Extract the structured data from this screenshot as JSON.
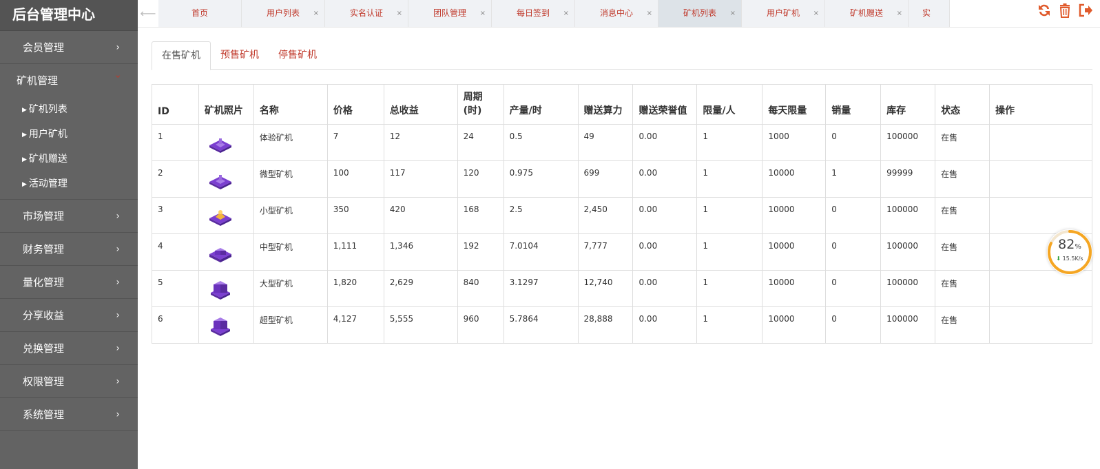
{
  "sidebar": {
    "brand": "后台管理中心",
    "menu": [
      {
        "label": "会员管理"
      },
      {
        "label": "矿机管理",
        "open": true,
        "children": [
          "矿机列表",
          "用户矿机",
          "矿机赠送",
          "活动管理"
        ]
      },
      {
        "label": "市场管理"
      },
      {
        "label": "财务管理"
      },
      {
        "label": "量化管理"
      },
      {
        "label": "分享收益"
      },
      {
        "label": "兑换管理"
      },
      {
        "label": "权限管理"
      },
      {
        "label": "系统管理"
      }
    ]
  },
  "tabbar": {
    "left_arrow": "⟵",
    "tabs": [
      {
        "label": "首页",
        "closable": false
      },
      {
        "label": "用户列表",
        "closable": true
      },
      {
        "label": "实名认证",
        "closable": true
      },
      {
        "label": "团队管理",
        "closable": true
      },
      {
        "label": "每日签到",
        "closable": true
      },
      {
        "label": "消息中心",
        "closable": true
      },
      {
        "label": "矿机列表",
        "closable": true,
        "active": true
      },
      {
        "label": "用户矿机",
        "closable": true
      },
      {
        "label": "矿机赠送",
        "closable": true
      },
      {
        "label": "实",
        "closable": false,
        "cut": true
      }
    ],
    "close_glyph": "×",
    "icons": [
      "refresh-icon",
      "trash-icon",
      "logout-icon"
    ]
  },
  "subtabs": [
    "在售矿机",
    "预售矿机",
    "停售矿机"
  ],
  "table": {
    "headers": [
      "ID",
      "矿机照片",
      "名称",
      "价格",
      "总收益",
      "周期\n(时)",
      "产量/时",
      "赠送算力",
      "赠送荣誉值",
      "限量/人",
      "每天限量",
      "销量",
      "库存",
      "状态",
      "操作"
    ],
    "rows": [
      [
        "1",
        "",
        "体验矿机",
        "7",
        "12",
        "24",
        "0.5",
        "49",
        "0.00",
        "1",
        "1000",
        "0",
        "100000",
        "在售",
        ""
      ],
      [
        "2",
        "",
        "微型矿机",
        "100",
        "117",
        "120",
        "0.975",
        "699",
        "0.00",
        "1",
        "10000",
        "1",
        "99999",
        "在售",
        ""
      ],
      [
        "3",
        "",
        "小型矿机",
        "350",
        "420",
        "168",
        "2.5",
        "2,450",
        "0.00",
        "1",
        "10000",
        "0",
        "100000",
        "在售",
        ""
      ],
      [
        "4",
        "",
        "中型矿机",
        "1,111",
        "1,346",
        "192",
        "7.0104",
        "7,777",
        "0.00",
        "1",
        "10000",
        "0",
        "100000",
        "在售",
        ""
      ],
      [
        "5",
        "",
        "大型矿机",
        "1,820",
        "2,629",
        "840",
        "3.1297",
        "12,740",
        "0.00",
        "1",
        "10000",
        "0",
        "100000",
        "在售",
        ""
      ],
      [
        "6",
        "",
        "超型矿机",
        "4,127",
        "5,555",
        "960",
        "5.7864",
        "28,888",
        "0.00",
        "1",
        "10000",
        "0",
        "100000",
        "在售",
        ""
      ]
    ]
  },
  "speed_widget": {
    "percent": "82",
    "percent_unit": "%",
    "rate": "15.5K/s",
    "fill": 0.82,
    "ring_color": "#f5a623"
  },
  "colors": {
    "accent": "#c0392b",
    "sidebar_bg": "#636363",
    "icon_orange": "#e05a2b",
    "machine_purple": "#7b3fd0"
  }
}
